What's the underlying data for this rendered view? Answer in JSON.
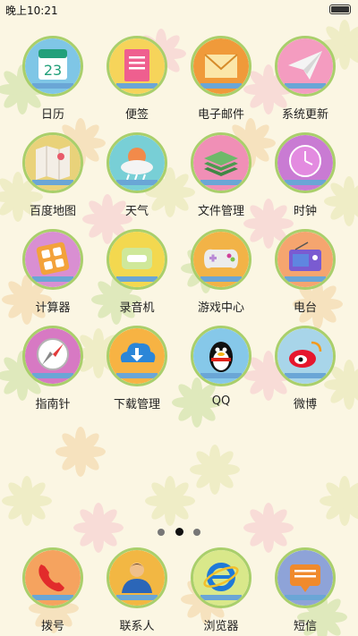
{
  "status": {
    "time": "晚上10:21"
  },
  "apps": [
    {
      "label": "日历",
      "icon": "calendar-icon",
      "bg": "#7fc6e6",
      "value": "23"
    },
    {
      "label": "便签",
      "icon": "note-icon",
      "bg": "#f6d45a"
    },
    {
      "label": "电子邮件",
      "icon": "mail-icon",
      "bg": "#f09a3a"
    },
    {
      "label": "系统更新",
      "icon": "paper-plane-icon",
      "bg": "#f49cc0"
    },
    {
      "label": "百度地图",
      "icon": "map-icon",
      "bg": "#e9d27a"
    },
    {
      "label": "天气",
      "icon": "weather-icon",
      "bg": "#78cfd6"
    },
    {
      "label": "文件管理",
      "icon": "layers-icon",
      "bg": "#f08fb6"
    },
    {
      "label": "时钟",
      "icon": "clock-icon",
      "bg": "#c97bd3"
    },
    {
      "label": "计算器",
      "icon": "calculator-icon",
      "bg": "#d98fd2"
    },
    {
      "label": "录音机",
      "icon": "recorder-icon",
      "bg": "#f3d84f"
    },
    {
      "label": "游戏中心",
      "icon": "gamepad-icon",
      "bg": "#f2b347"
    },
    {
      "label": "电台",
      "icon": "radio-icon",
      "bg": "#f5a56f"
    },
    {
      "label": "指南针",
      "icon": "compass-icon",
      "bg": "#d779c3"
    },
    {
      "label": "下载管理",
      "icon": "download-icon",
      "bg": "#f7b343"
    },
    {
      "label": "QQ",
      "icon": "qq-penguin-icon",
      "bg": "#86c8e9"
    },
    {
      "label": "微博",
      "icon": "weibo-icon",
      "bg": "#a8d5e9"
    }
  ],
  "dock": [
    {
      "label": "拨号",
      "icon": "phone-icon",
      "bg": "#f5a35f"
    },
    {
      "label": "联系人",
      "icon": "contact-icon",
      "bg": "#f2b743"
    },
    {
      "label": "浏览器",
      "icon": "browser-icon",
      "bg": "#d9e88a"
    },
    {
      "label": "短信",
      "icon": "message-icon",
      "bg": "#8ea3d8"
    }
  ],
  "pager": {
    "pages": 3,
    "active": 1
  }
}
